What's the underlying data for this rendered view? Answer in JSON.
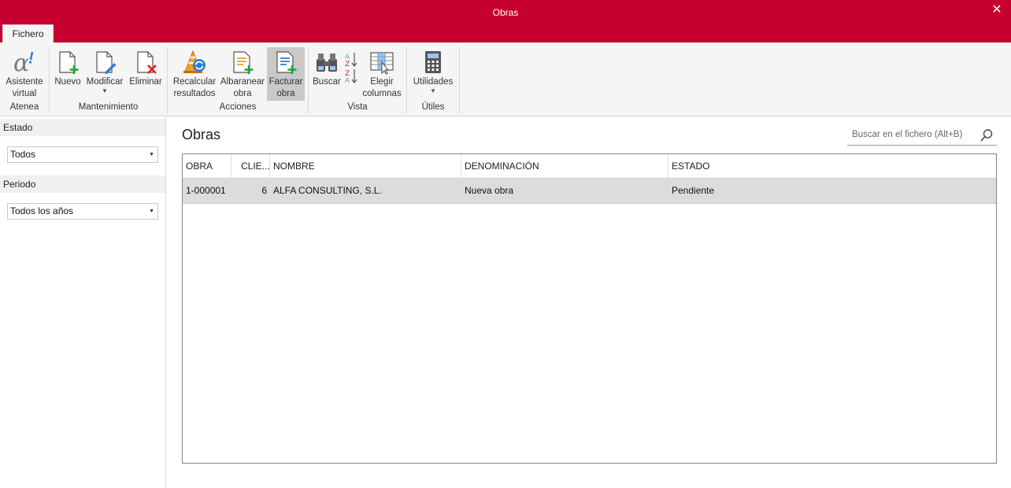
{
  "window": {
    "title": "Obras"
  },
  "ribbon": {
    "tab": "Fichero",
    "groups": {
      "atenea": "Atenea",
      "mantenimiento": "Mantenimiento",
      "acciones": "Acciones",
      "vista": "Vista",
      "utiles": "Útiles"
    },
    "buttons": {
      "asistente": [
        "Asistente",
        "virtual"
      ],
      "nuevo": "Nuevo",
      "modificar": "Modificar",
      "eliminar": "Eliminar",
      "recalcular": [
        "Recalcular",
        "resultados"
      ],
      "albaranear": [
        "Albaranear",
        "obra"
      ],
      "facturar": [
        "Facturar",
        "obra"
      ],
      "buscar": "Buscar",
      "elegir": [
        "Elegir",
        "columnas"
      ],
      "utilidades": "Utilidades"
    },
    "colors": {
      "accent": "#c8002f",
      "green": "#2aa038",
      "red": "#d9202a",
      "blue": "#2d7fd6"
    }
  },
  "sidebar": {
    "estado_label": "Estado",
    "estado_value": "Todos",
    "periodo_label": "Periodo",
    "periodo_value": "Todos los años"
  },
  "main": {
    "title": "Obras",
    "search_placeholder": "Buscar en el fichero (Alt+B)",
    "columns": [
      "OBRA",
      "CLIE...",
      "NOMBRE",
      "DENOMINACIÓN",
      "ESTADO"
    ],
    "rows": [
      {
        "obra": "1-000001",
        "cliente": "6",
        "nombre": "ALFA CONSULTING, S.L.",
        "denominacion": "Nueva obra",
        "estado": "Pendiente"
      }
    ]
  }
}
